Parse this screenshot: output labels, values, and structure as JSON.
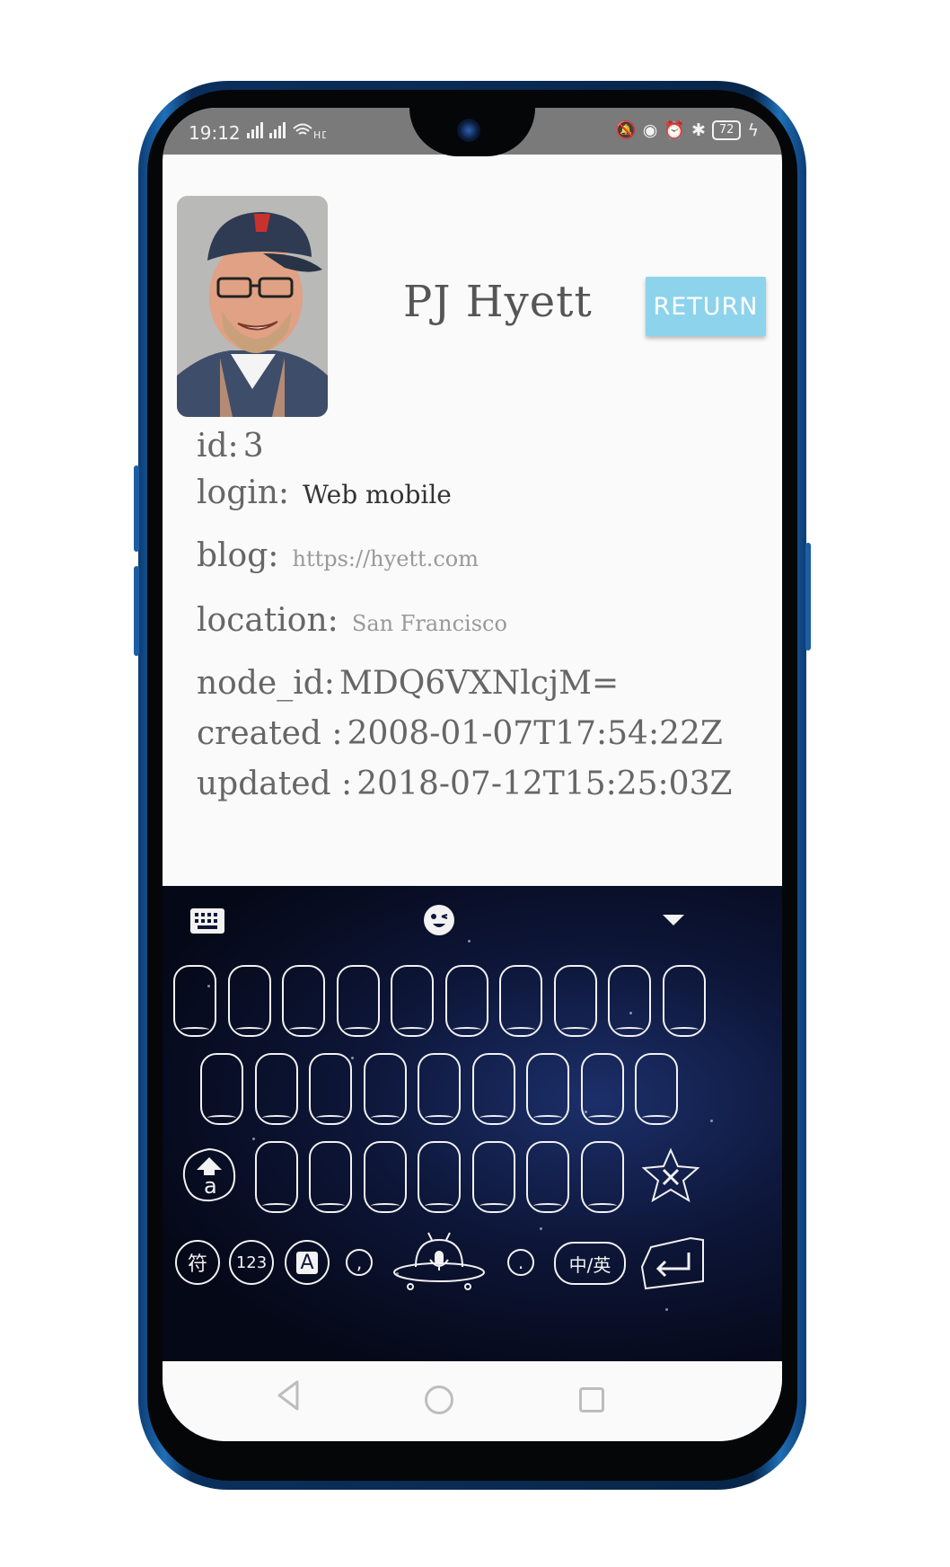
{
  "status": {
    "time": "19:12",
    "network": "4G 4G",
    "battery": "72"
  },
  "profile": {
    "name": "PJ Hyett",
    "return_label": "RETURN",
    "fields": {
      "id_label": "id:",
      "id_value": "3",
      "login_label": "login:",
      "login_value": "Web mobile",
      "blog_label": "blog:",
      "blog_value": "https://hyett.com",
      "location_label": "location:",
      "location_value": "San Francisco",
      "node_id_label": "node_id:",
      "node_id_value": "MDQ6VXNlcjM=",
      "created_label": "created :",
      "created_value": "2008-01-07T17:54:22Z",
      "updated_label": "updated :",
      "updated_value": "2018-07-12T15:25:03Z"
    }
  },
  "keyboard": {
    "shift_letter": "a",
    "symbols_label": "符",
    "numbers_label": "123",
    "alpha_label": "A",
    "comma_label": ",",
    "period_label": ".",
    "lang_label": "中/英",
    "icons": [
      "keyboard-icon",
      "emoji-icon",
      "collapse-icon",
      "shift-icon",
      "delete-icon",
      "microphone-icon",
      "enter-icon"
    ]
  },
  "colors": {
    "accent": "#8dd3ec",
    "phone_frame": "#1f6fb8"
  }
}
